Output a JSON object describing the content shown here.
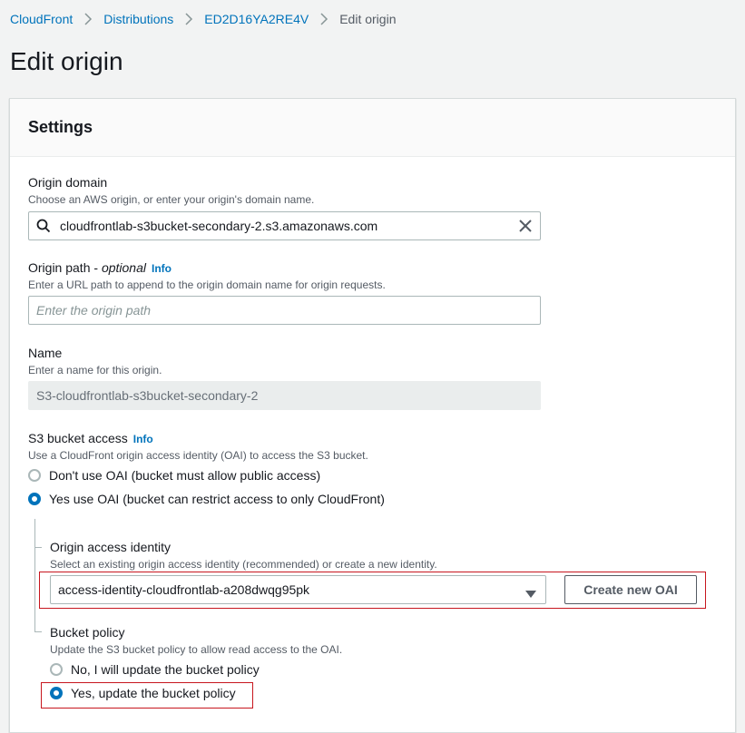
{
  "breadcrumb": {
    "items": [
      "CloudFront",
      "Distributions",
      "ED2D16YA2RE4V"
    ],
    "current": "Edit origin"
  },
  "page": {
    "title": "Edit origin"
  },
  "settings": {
    "heading": "Settings",
    "origin_domain": {
      "label": "Origin domain",
      "description": "Choose an AWS origin, or enter your origin's domain name.",
      "value": "cloudfrontlab-s3bucket-secondary-2.s3.amazonaws.com"
    },
    "origin_path": {
      "label": "Origin path - ",
      "label_optional": "optional",
      "info": "Info",
      "description": "Enter a URL path to append to the origin domain name for origin requests.",
      "placeholder": "Enter the origin path"
    },
    "name": {
      "label": "Name",
      "description": "Enter a name for this origin.",
      "value": "S3-cloudfrontlab-s3bucket-secondary-2"
    },
    "s3_bucket_access": {
      "label": "S3 bucket access",
      "info": "Info",
      "description": "Use a CloudFront origin access identity (OAI) to access the S3 bucket.",
      "options": [
        {
          "label": "Don't use OAI (bucket must allow public access)",
          "checked": false
        },
        {
          "label": "Yes use OAI (bucket can restrict access to only CloudFront)",
          "checked": true
        }
      ]
    },
    "origin_access_identity": {
      "label": "Origin access identity",
      "description": "Select an existing origin access identity (recommended) or create a new identity.",
      "selected": "access-identity-cloudfrontlab-a208dwqg95pk",
      "create_button": "Create new OAI"
    },
    "bucket_policy": {
      "label": "Bucket policy",
      "description": "Update the S3 bucket policy to allow read access to the OAI.",
      "options": [
        {
          "label": "No, I will update the bucket policy",
          "checked": false
        },
        {
          "label": "Yes, update the bucket policy",
          "checked": true
        }
      ]
    }
  },
  "colors": {
    "link": "#0073bb",
    "highlight_border": "#c7161e",
    "radio_selected": "#0073bb"
  }
}
